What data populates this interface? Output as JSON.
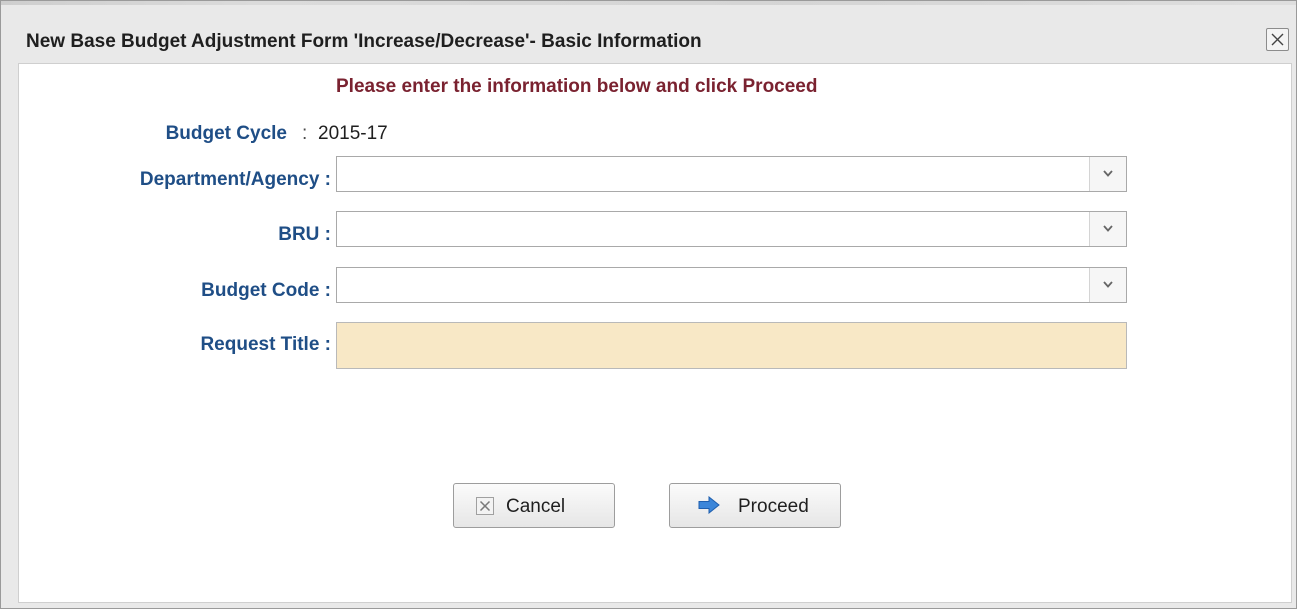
{
  "dialog": {
    "title": "New Base Budget Adjustment Form 'Increase/Decrease'- Basic Information",
    "close_icon": "close-icon"
  },
  "form": {
    "instruction": "Please enter the information below and click Proceed",
    "budget_cycle": {
      "label": "Budget Cycle",
      "separator": ":",
      "value": "2015-17"
    },
    "department_agency": {
      "label": "Department/Agency :",
      "value": ""
    },
    "bru": {
      "label": "BRU :",
      "value": ""
    },
    "budget_code": {
      "label": "Budget Code :",
      "value": ""
    },
    "request_title": {
      "label": "Request Title :",
      "value": ""
    }
  },
  "buttons": {
    "cancel": {
      "label": "Cancel",
      "icon": "cancel-x-icon"
    },
    "proceed": {
      "label": "Proceed",
      "icon": "arrow-right-icon"
    }
  },
  "colors": {
    "label_blue": "#1f4e86",
    "instruction_red": "#7a2230",
    "required_field_bg": "#f8e8c6",
    "arrow_blue": "#3c86d9"
  }
}
